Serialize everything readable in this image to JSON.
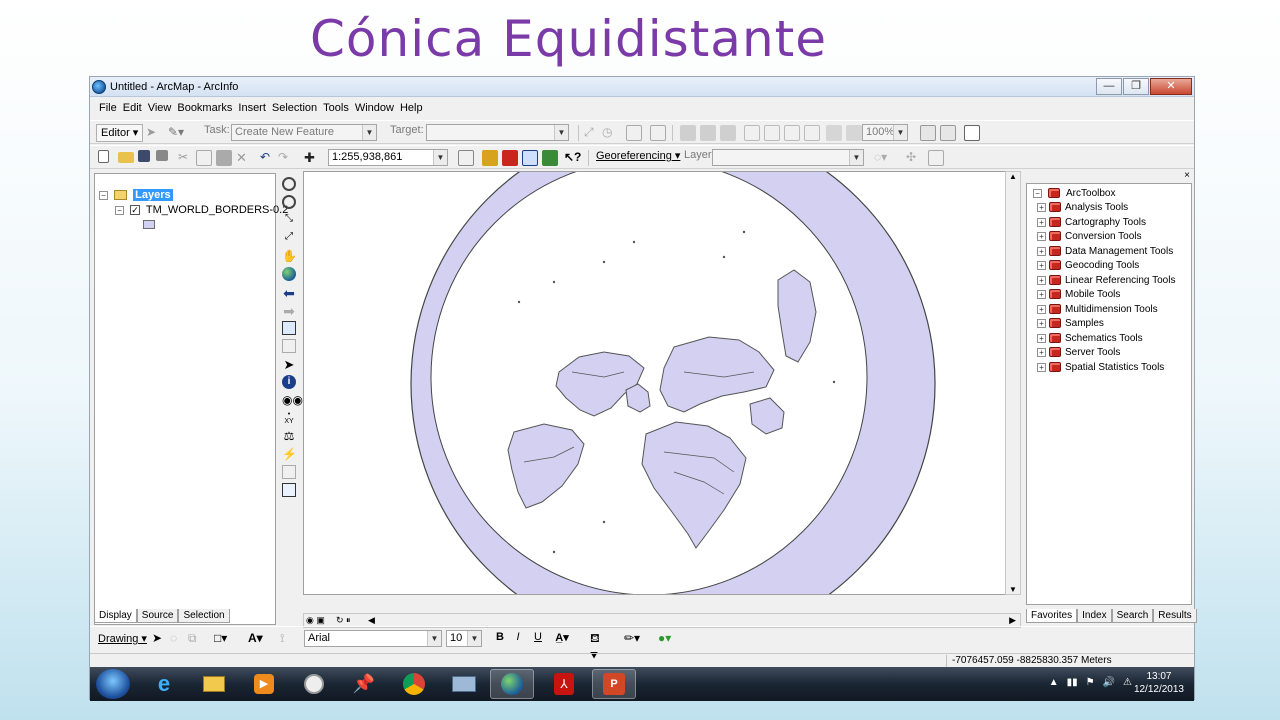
{
  "slide": {
    "title": "Cónica Equidistante"
  },
  "window": {
    "title": "Untitled - ArcMap - ArcInfo",
    "btn_min": "—",
    "btn_max": "❐",
    "btn_close": "✕"
  },
  "menu": [
    "File",
    "Edit",
    "View",
    "Bookmarks",
    "Insert",
    "Selection",
    "Tools",
    "Window",
    "Help"
  ],
  "toolbar1": {
    "editor_label": "Editor",
    "task_label": "Task:",
    "task_value": "Create New Feature",
    "target_label": "Target:",
    "target_value": "",
    "zoom_value": "100%"
  },
  "toolbar2": {
    "scale_value": "1:255,938,861",
    "georef_label": "Georeferencing",
    "layer_label": "Layer:",
    "layer_value": ""
  },
  "toc": {
    "root_label": "Layers",
    "layer_name": "TM_WORLD_BORDERS-0.2",
    "tabs": [
      "Display",
      "Source",
      "Selection"
    ]
  },
  "toolbox": {
    "root": "ArcToolbox",
    "items": [
      "Analysis Tools",
      "Cartography Tools",
      "Conversion Tools",
      "Data Management Tools",
      "Geocoding Tools",
      "Linear Referencing Tools",
      "Mobile Tools",
      "Multidimension Tools",
      "Samples",
      "Schematics Tools",
      "Server Tools",
      "Spatial Statistics Tools"
    ],
    "tabs": [
      "Favorites",
      "Index",
      "Search",
      "Results"
    ]
  },
  "drawing": {
    "drawing_label": "Drawing",
    "font_value": "Arial",
    "size_value": "10",
    "bold": "B",
    "italic": "I",
    "underline": "U",
    "text_tool": "A"
  },
  "status": {
    "coords": "-7076457.059  -8825830.357 Meters"
  },
  "taskbar": {
    "time": "13:07",
    "date": "12/12/2013",
    "apps": [
      "start-orb",
      "internet-explorer",
      "file-explorer",
      "media-player",
      "clock-app",
      "pushpin-app",
      "chrome",
      "network-app",
      "arcmap",
      "adobe-reader",
      "powerpoint"
    ]
  },
  "colors": {
    "title_purple": "#7a3aa8",
    "land_fill": "#d3d0f1",
    "boundary": "#555555",
    "selection_blue": "#3399ff"
  }
}
